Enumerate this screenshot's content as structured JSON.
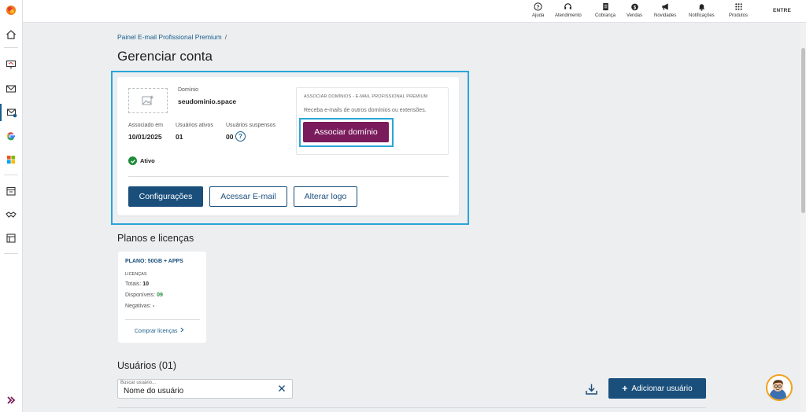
{
  "topbar": {
    "items": [
      {
        "label": "Ajuda",
        "icon": "help-circle-icon"
      },
      {
        "label": "Atendimento",
        "icon": "headset-icon"
      },
      {
        "label": "Cobrança",
        "icon": "invoice-icon"
      },
      {
        "label": "Vendas",
        "icon": "money-bag-icon"
      },
      {
        "label": "Novidades",
        "icon": "megaphone-icon"
      },
      {
        "label": "Notificações",
        "icon": "bell-icon"
      },
      {
        "label": "Produtos",
        "icon": "grid-icon"
      }
    ],
    "login_label": "ENTRE"
  },
  "breadcrumb": {
    "item": "Painel E-mail Profissional Premium",
    "separator": "/"
  },
  "page_title": "Gerenciar conta",
  "account": {
    "domain_label": "Domínio",
    "domain_value": "seudominio.space",
    "associated_label": "Associado em",
    "associated_value": "10/01/2025",
    "active_users_label": "Usuários ativos",
    "active_users_value": "01",
    "suspended_users_label": "Usuários suspensos",
    "suspended_users_value": "00",
    "help_glyph": "?",
    "status": "Ativo"
  },
  "associate": {
    "title": "ASSOCIAR DOMÍNIOS - E-MAIL PROFISSIONAL PREMIUM",
    "description": "Receba e-mails de outros domínios ou extensões.",
    "button": "Associar domínio"
  },
  "actions": {
    "settings": "Configurações",
    "access_email": "Acessar E-mail",
    "change_logo": "Alterar logo"
  },
  "plans": {
    "section_title": "Planos e licenças",
    "plan_name": "PLANO: 50GB + APPS",
    "licenses_label": "LICENÇAS",
    "total_label": "Totais:",
    "total_value": "10",
    "available_label": "Disponíveis:",
    "available_value": "09",
    "negative_label": "Negativas:",
    "negative_value": "-",
    "buy_link": "Comprar licenças"
  },
  "users": {
    "section_title": "Usuários (01)",
    "search_placeholder": "Buscar usuário...",
    "search_value": "Nome do usuário",
    "add_button": "Adicionar usuário"
  },
  "colors": {
    "primary": "#1a4f7c",
    "accent_purple": "#7a1b5c",
    "highlight": "#29a6d8",
    "success": "#1e8c3a"
  }
}
